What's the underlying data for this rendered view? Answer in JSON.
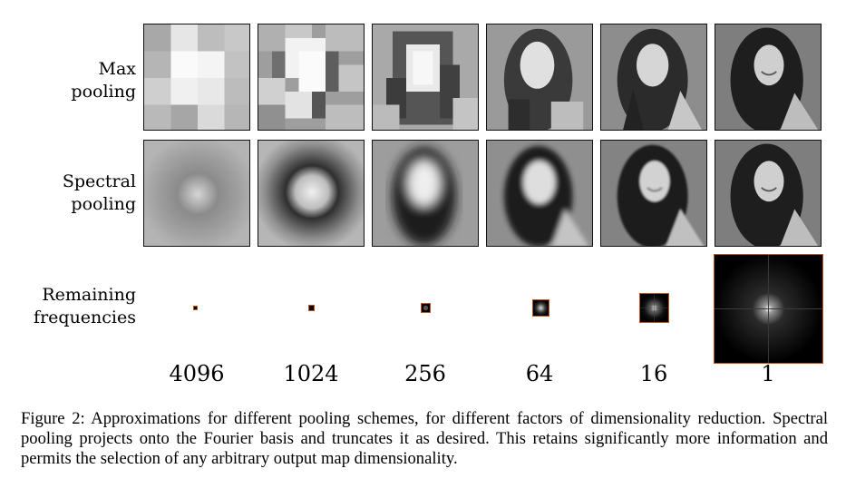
{
  "figure": {
    "rows": [
      {
        "label": "Max\npooling"
      },
      {
        "label": "Spectral\npooling"
      },
      {
        "label": "Remaining\nfrequencies"
      }
    ],
    "factors": [
      "4096",
      "1024",
      "256",
      "64",
      "16",
      "1"
    ],
    "caption": "Figure 2: Approximations for different pooling schemes, for different factors of dimensionality reduction. Spectral pooling projects onto the Fourier basis and truncates it as desired. This retains significantly more information and permits the selection of any arbitrary output map dimensionality."
  },
  "colors": {
    "frequency_border": "#c0541b",
    "tile_border": "#111111"
  }
}
